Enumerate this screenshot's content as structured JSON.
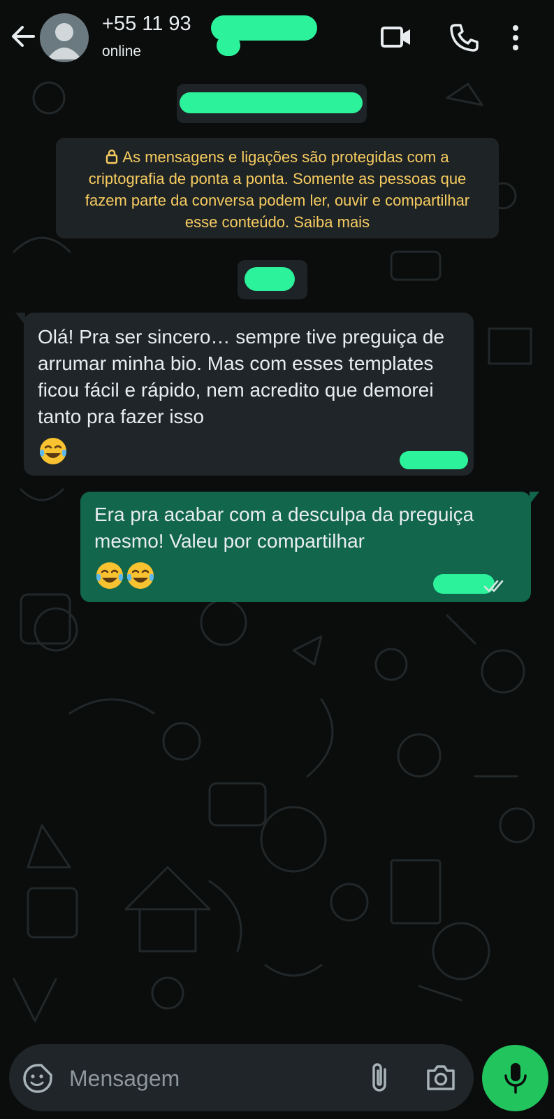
{
  "header": {
    "contact_name": "+55 11 93",
    "status": "online",
    "icons": [
      "back-arrow-icon",
      "avatar-placeholder-icon",
      "video-call-icon",
      "phone-icon",
      "more-options-icon"
    ]
  },
  "encryption_notice": {
    "text": "As mensagens e ligações são protegidas com a criptografia de ponta a ponta. Somente as pessoas que fazem parte da conversa podem ler, ouvir e compartilhar esse conteúdo. Saiba mais",
    "icon": "lock-icon"
  },
  "messages": [
    {
      "direction": "incoming",
      "text": "Olá! Pra ser sincero… sempre tive preguiça de arrumar minha bio. Mas com esses templates ficou fácil e rápido, nem acredito que demorei tanto pra fazer isso",
      "emojis": [
        "😂"
      ]
    },
    {
      "direction": "outgoing",
      "text": "Era pra acabar com a desculpa da preguiça mesmo! Valeu por compartilhar",
      "emojis": [
        "😂",
        "😂"
      ],
      "status_icon": "double-check-icon"
    }
  ],
  "composer": {
    "placeholder": "Mensagem",
    "icons": [
      "emoji-sticker-icon",
      "attach-clip-icon",
      "camera-icon",
      "microphone-icon"
    ]
  },
  "colors": {
    "background": "#0b0d0c",
    "incoming_bubble": "#1f2528",
    "outgoing_bubble": "#11664c",
    "notice_text": "#f7cc60",
    "mic_button": "#22c45e",
    "redaction": "#2cf39b"
  }
}
